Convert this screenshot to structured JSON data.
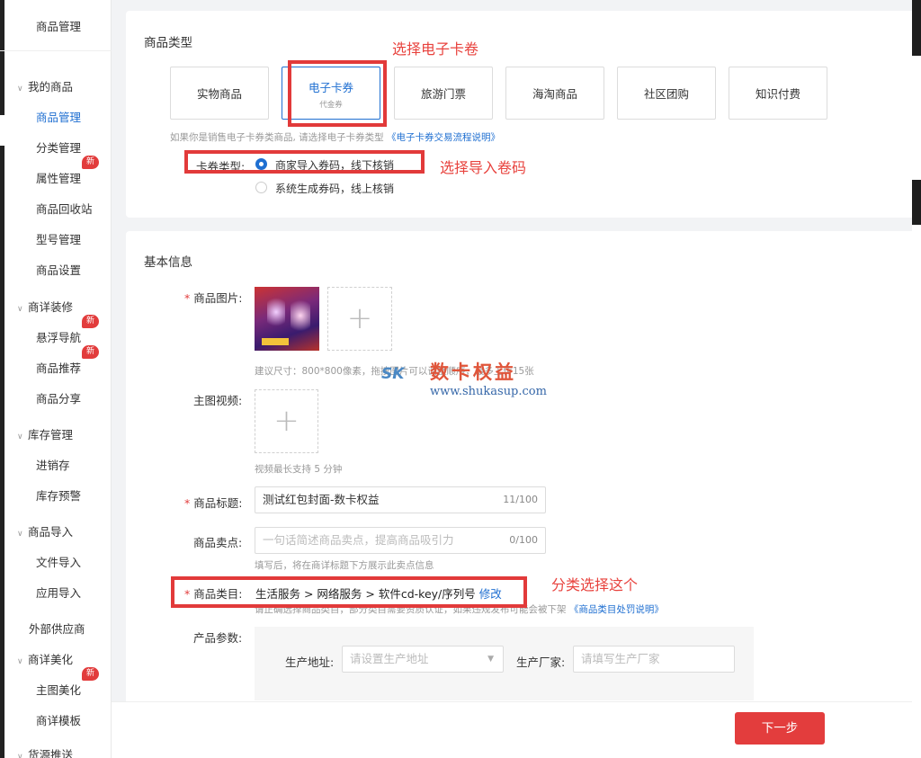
{
  "sidebar": {
    "top_item": "商品管理",
    "groups": {
      "my_goods": "我的商品",
      "detail_decor": "商详装修",
      "stock_mgmt": "库存管理",
      "goods_import": "商品导入",
      "external_supplier": "外部供应商",
      "detail_beautify": "商详美化",
      "cut_off": "货源推送"
    },
    "items": {
      "goods_mgmt": "商品管理",
      "category_mgmt": "分类管理",
      "attr_mgmt": "属性管理",
      "recycle": "商品回收站",
      "model_mgmt": "型号管理",
      "goods_settings": "商品设置",
      "float_nav": "悬浮导航",
      "recommend": "商品推荐",
      "share": "商品分享",
      "purchase_sale": "进销存",
      "stock_alert": "库存预警",
      "file_import": "文件导入",
      "app_import": "应用导入",
      "main_img": "主图美化",
      "detail_template": "商详模板"
    },
    "new_badge": "新"
  },
  "type_panel": {
    "title": "商品类型",
    "cards": [
      {
        "label": "实物商品"
      },
      {
        "label": "电子卡券",
        "sub": "代金券"
      },
      {
        "label": "旅游门票"
      },
      {
        "label": "海淘商品"
      },
      {
        "label": "社区团购"
      },
      {
        "label": "知识付费"
      }
    ],
    "hint": "如果你是销售电子卡券类商品, 请选择电子卡券类型",
    "hint_link": "《电子卡券交易流程说明》",
    "card_type_label": "卡券类型:",
    "radio_1": "商家导入券码，线下核销",
    "radio_2": "系统生成券码，线上核销"
  },
  "basic_panel": {
    "title": "基本信息",
    "image_label": "商品图片:",
    "image_hint": "建议尺寸：800*800像素，拖拽图片可以调整顺序，最多上传15张",
    "video_label": "主图视频:",
    "video_hint": "视频最长支持 5 分钟",
    "title_label": "商品标题:",
    "title_value": "测试红包封面-数卡权益",
    "title_count": "11/100",
    "selling_label": "商品卖点:",
    "selling_placeholder": "一句话简述商品卖点，提高商品吸引力",
    "selling_count": "0/100",
    "selling_hint": "填写后，将在商详标题下方展示此卖点信息",
    "category_label": "商品类目:",
    "category_value": "生活服务 > 网络服务 > 软件cd-key/序列号",
    "category_edit": "修改",
    "category_hint": "请正确选择商品类目，部分类目需要资质认证，如果违规发布可能会被下架",
    "category_hint_link": "《商品类目处罚说明》",
    "params_label": "产品参数:",
    "origin_label": "生产地址:",
    "origin_placeholder": "请设置生产地址",
    "maker_label": "生产厂家:",
    "maker_placeholder": "请填写生产厂家"
  },
  "annotations": {
    "select_ecard": "选择电子卡卷",
    "select_import": "选择导入卷码",
    "select_category": "分类选择这个"
  },
  "watermark": {
    "logo": "SK",
    "name": "数卡权益",
    "url": "www.shukasup.com"
  },
  "footer": {
    "next": "下一步"
  },
  "colors": {
    "accent": "#1f6fd1",
    "danger": "#e33d3d",
    "annotation": "#e8433e"
  }
}
